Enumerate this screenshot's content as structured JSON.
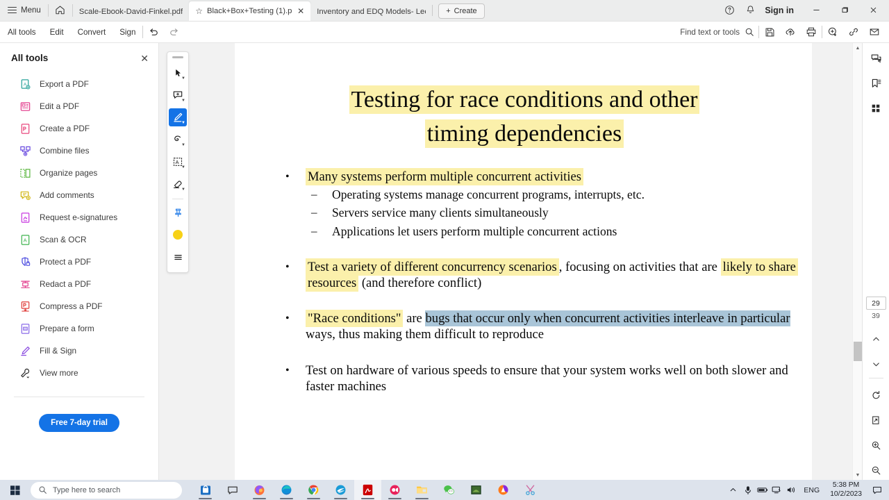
{
  "window": {
    "menu_label": "Menu",
    "home_icon": "home-icon",
    "signin_label": "Sign in",
    "help_icon": "help-circle-icon",
    "bell_icon": "bell-icon",
    "minimize_label": "—",
    "maximize_label": "❐",
    "close_label": "✕"
  },
  "tabs": [
    {
      "label": "Scale-Ebook-David-Finkel.pdf",
      "active": false,
      "starred": false,
      "closable": false
    },
    {
      "label": "Black+Box+Testing (1).p..",
      "active": true,
      "starred": true,
      "closable": true
    },
    {
      "label": "Inventory and EDQ Models- Lect..",
      "active": false,
      "starred": false,
      "closable": false
    }
  ],
  "create_button": {
    "label": "Create",
    "icon": "plus-icon"
  },
  "toolrow": {
    "items": [
      "All tools",
      "Edit",
      "Convert",
      "Sign"
    ],
    "undo_icon": "undo-icon",
    "redo_icon": "redo-icon",
    "find_placeholder": "Find text or tools",
    "search_icon": "search-icon",
    "right_icons": [
      "save-icon",
      "upload-cloud-icon",
      "print-icon",
      "add-stamp-icon",
      "link-icon",
      "mail-icon"
    ]
  },
  "all_tools_panel": {
    "title": "All tools",
    "close_icon": "close-icon",
    "items": [
      {
        "label": "Export a PDF",
        "icon": "export-pdf-icon",
        "color": "#2aa39a"
      },
      {
        "label": "Edit a PDF",
        "icon": "edit-pdf-icon",
        "color": "#e3408f"
      },
      {
        "label": "Create a PDF",
        "icon": "create-pdf-icon",
        "color": "#e8467c"
      },
      {
        "label": "Combine files",
        "icon": "combine-files-icon",
        "color": "#6a4be0"
      },
      {
        "label": "Organize pages",
        "icon": "organize-pages-icon",
        "color": "#5bb73f"
      },
      {
        "label": "Add comments",
        "icon": "add-comments-icon",
        "color": "#d0b512"
      },
      {
        "label": "Request e-signatures",
        "icon": "request-esign-icon",
        "color": "#c83ae0"
      },
      {
        "label": "Scan & OCR",
        "icon": "scan-ocr-icon",
        "color": "#3fb34f"
      },
      {
        "label": "Protect a PDF",
        "icon": "protect-pdf-icon",
        "color": "#4b4be0"
      },
      {
        "label": "Redact a PDF",
        "icon": "redact-pdf-icon",
        "color": "#e3408f"
      },
      {
        "label": "Compress a PDF",
        "icon": "compress-pdf-icon",
        "color": "#e0413f"
      },
      {
        "label": "Prepare a form",
        "icon": "prepare-form-icon",
        "color": "#8a6ae8"
      },
      {
        "label": "Fill & Sign",
        "icon": "fill-sign-icon",
        "color": "#8a4be0"
      },
      {
        "label": "View more",
        "icon": "view-more-icon",
        "color": "#2b2b2b"
      }
    ],
    "trial_button": "Free 7-day trial"
  },
  "annotation_toolbar": {
    "tools": [
      {
        "icon": "select-cursor-icon",
        "active": false,
        "has_caret": true
      },
      {
        "icon": "add-comment-icon",
        "active": false,
        "has_caret": true
      },
      {
        "icon": "highlight-pen-icon",
        "active": true,
        "has_caret": true
      },
      {
        "icon": "freehand-draw-icon",
        "active": false,
        "has_caret": true
      },
      {
        "icon": "add-text-box-icon",
        "active": false,
        "has_caret": true
      },
      {
        "icon": "eraser-icon",
        "active": false,
        "has_caret": true
      },
      {
        "icon": "pin-stamp-icon",
        "active": false,
        "has_caret": false
      },
      {
        "icon": "color-swatch-icon",
        "active": false,
        "has_caret": false,
        "color": "#f7d117"
      },
      {
        "icon": "more-options-icon",
        "active": false,
        "has_caret": false
      }
    ]
  },
  "document": {
    "title_lines": [
      "Testing for race conditions and other",
      "timing dependencies"
    ],
    "bullets": [
      {
        "text_highlighted": "Many systems perform multiple concurrent activities",
        "highlight": "yellow",
        "sub": [
          "Operating systems manage concurrent programs, interrupts, etc.",
          "Servers service many clients simultaneously",
          "Applications let users perform multiple concurrent actions"
        ]
      },
      {
        "segments": [
          {
            "text": "Test a variety of different concurrency scenarios",
            "highlight": "yellow"
          },
          {
            "text": ", focusing on activities that are ",
            "highlight": "none"
          },
          {
            "text": "likely to share resources",
            "highlight": "yellow"
          },
          {
            "text": " (and therefore conflict)",
            "highlight": "none"
          }
        ]
      },
      {
        "segments": [
          {
            "text": "\"Race conditions\"",
            "highlight": "yellow"
          },
          {
            "text": " are ",
            "highlight": "none"
          },
          {
            "text": "bugs that occur only when concurrent activities interleave in particular",
            "highlight": "blue"
          },
          {
            "text": " ways, thus making them difficult to reproduce",
            "highlight": "none"
          }
        ]
      },
      {
        "segments": [
          {
            "text": "Test on hardware of various speeds to ensure that your system works well on both slower and faster machines",
            "highlight": "none"
          }
        ]
      }
    ],
    "highlight_colors": {
      "yellow": "#fbf0ab",
      "blue": "#a9c5d8"
    }
  },
  "right_rail": {
    "top_icons": [
      "comments-panel-icon",
      "bookmarks-panel-icon",
      "page-thumbnails-icon"
    ],
    "current_page": "29",
    "total_pages": "39",
    "prev_page_icon": "chevron-up-icon",
    "next_page_icon": "chevron-down-icon",
    "bottom_icons": [
      "rotate-page-icon",
      "fit-page-icon",
      "zoom-in-icon",
      "zoom-out-icon"
    ]
  },
  "taskbar": {
    "start_icon": "windows-start-icon",
    "search_placeholder": "Type here to search",
    "search_icon": "search-icon",
    "apps": [
      {
        "name": "microsoft-store-icon",
        "open": true,
        "active": false
      },
      {
        "name": "chat-icon",
        "open": false,
        "active": false
      },
      {
        "name": "firefox-icon",
        "open": true,
        "active": false
      },
      {
        "name": "microsoft-edge-icon",
        "open": true,
        "active": false
      },
      {
        "name": "google-chrome-icon",
        "open": true,
        "active": false
      },
      {
        "name": "teal-app-icon",
        "open": true,
        "active": false
      },
      {
        "name": "adobe-acrobat-icon",
        "open": true,
        "active": true
      },
      {
        "name": "screen-recorder-icon",
        "open": true,
        "active": false
      },
      {
        "name": "file-explorer-icon",
        "open": true,
        "active": false
      },
      {
        "name": "wechat-icon",
        "open": false,
        "active": false
      },
      {
        "name": "green-app-icon",
        "open": false,
        "active": false
      },
      {
        "name": "avast-browser-icon",
        "open": false,
        "active": false
      },
      {
        "name": "snipping-tool-icon",
        "open": false,
        "active": false
      }
    ],
    "tray": {
      "overflow_icon": "chevron-up-icon",
      "mic_icon": "microphone-icon",
      "battery_icon": "battery-icon",
      "network_icon": "network-display-icon",
      "volume_icon": "volume-icon",
      "language": "ENG",
      "time": "5:38 PM",
      "date": "10/2/2023",
      "notification_icon": "notification-icon"
    }
  }
}
